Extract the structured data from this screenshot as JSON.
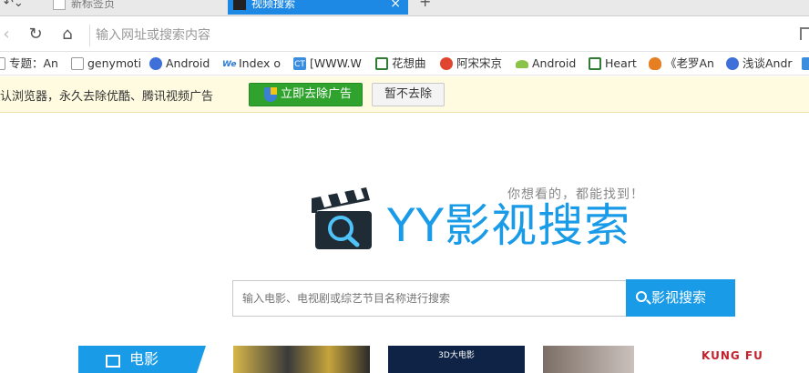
{
  "tabs": [
    {
      "title": "新标签页"
    },
    {
      "title": "视频搜索",
      "close": "×"
    }
  ],
  "tab_controls": {
    "back_glyph": "↶⌄",
    "new_tab": "+"
  },
  "address_bar": {
    "placeholder": "输入网址或搜索内容"
  },
  "bookmarks": [
    {
      "label": "专题：An",
      "icon": "page-icon"
    },
    {
      "label": "genymoti",
      "icon": "page-icon"
    },
    {
      "label": "Android",
      "icon": "site-icon"
    },
    {
      "label": "Index o",
      "icon": "web-icon"
    },
    {
      "label": "[WWW.W",
      "icon": "ct-icon"
    },
    {
      "label": "花想曲",
      "icon": "douban-icon"
    },
    {
      "label": "阿宋宋京",
      "icon": "red-icon"
    },
    {
      "label": "Android",
      "icon": "android-icon"
    },
    {
      "label": "Heart",
      "icon": "douban-icon"
    },
    {
      "label": "《老罗An",
      "icon": "fox-icon"
    },
    {
      "label": "浅谈Andr",
      "icon": "site-icon"
    }
  ],
  "notice": {
    "text": "默认浏览器，永久去除优酷、腾讯视频广告",
    "primary_button": "立即去除广告",
    "secondary_button": "暂不去除"
  },
  "site": {
    "slogan": "你想看的，都能找到！",
    "title": "YY影视搜索",
    "search_placeholder": "输入电影、电视剧或综艺节目名称进行搜索",
    "search_button": "影视搜索"
  },
  "category_tab": "电影",
  "posters": [
    {
      "caption": ""
    },
    {
      "caption": "3D大电影"
    },
    {
      "caption": ""
    },
    {
      "caption": "KUNG FU"
    }
  ],
  "colors": {
    "accent": "#1a9be8",
    "tab_active": "#1e88e5",
    "ad_button": "#2fa32d",
    "notice_bg": "#fffbe0"
  }
}
